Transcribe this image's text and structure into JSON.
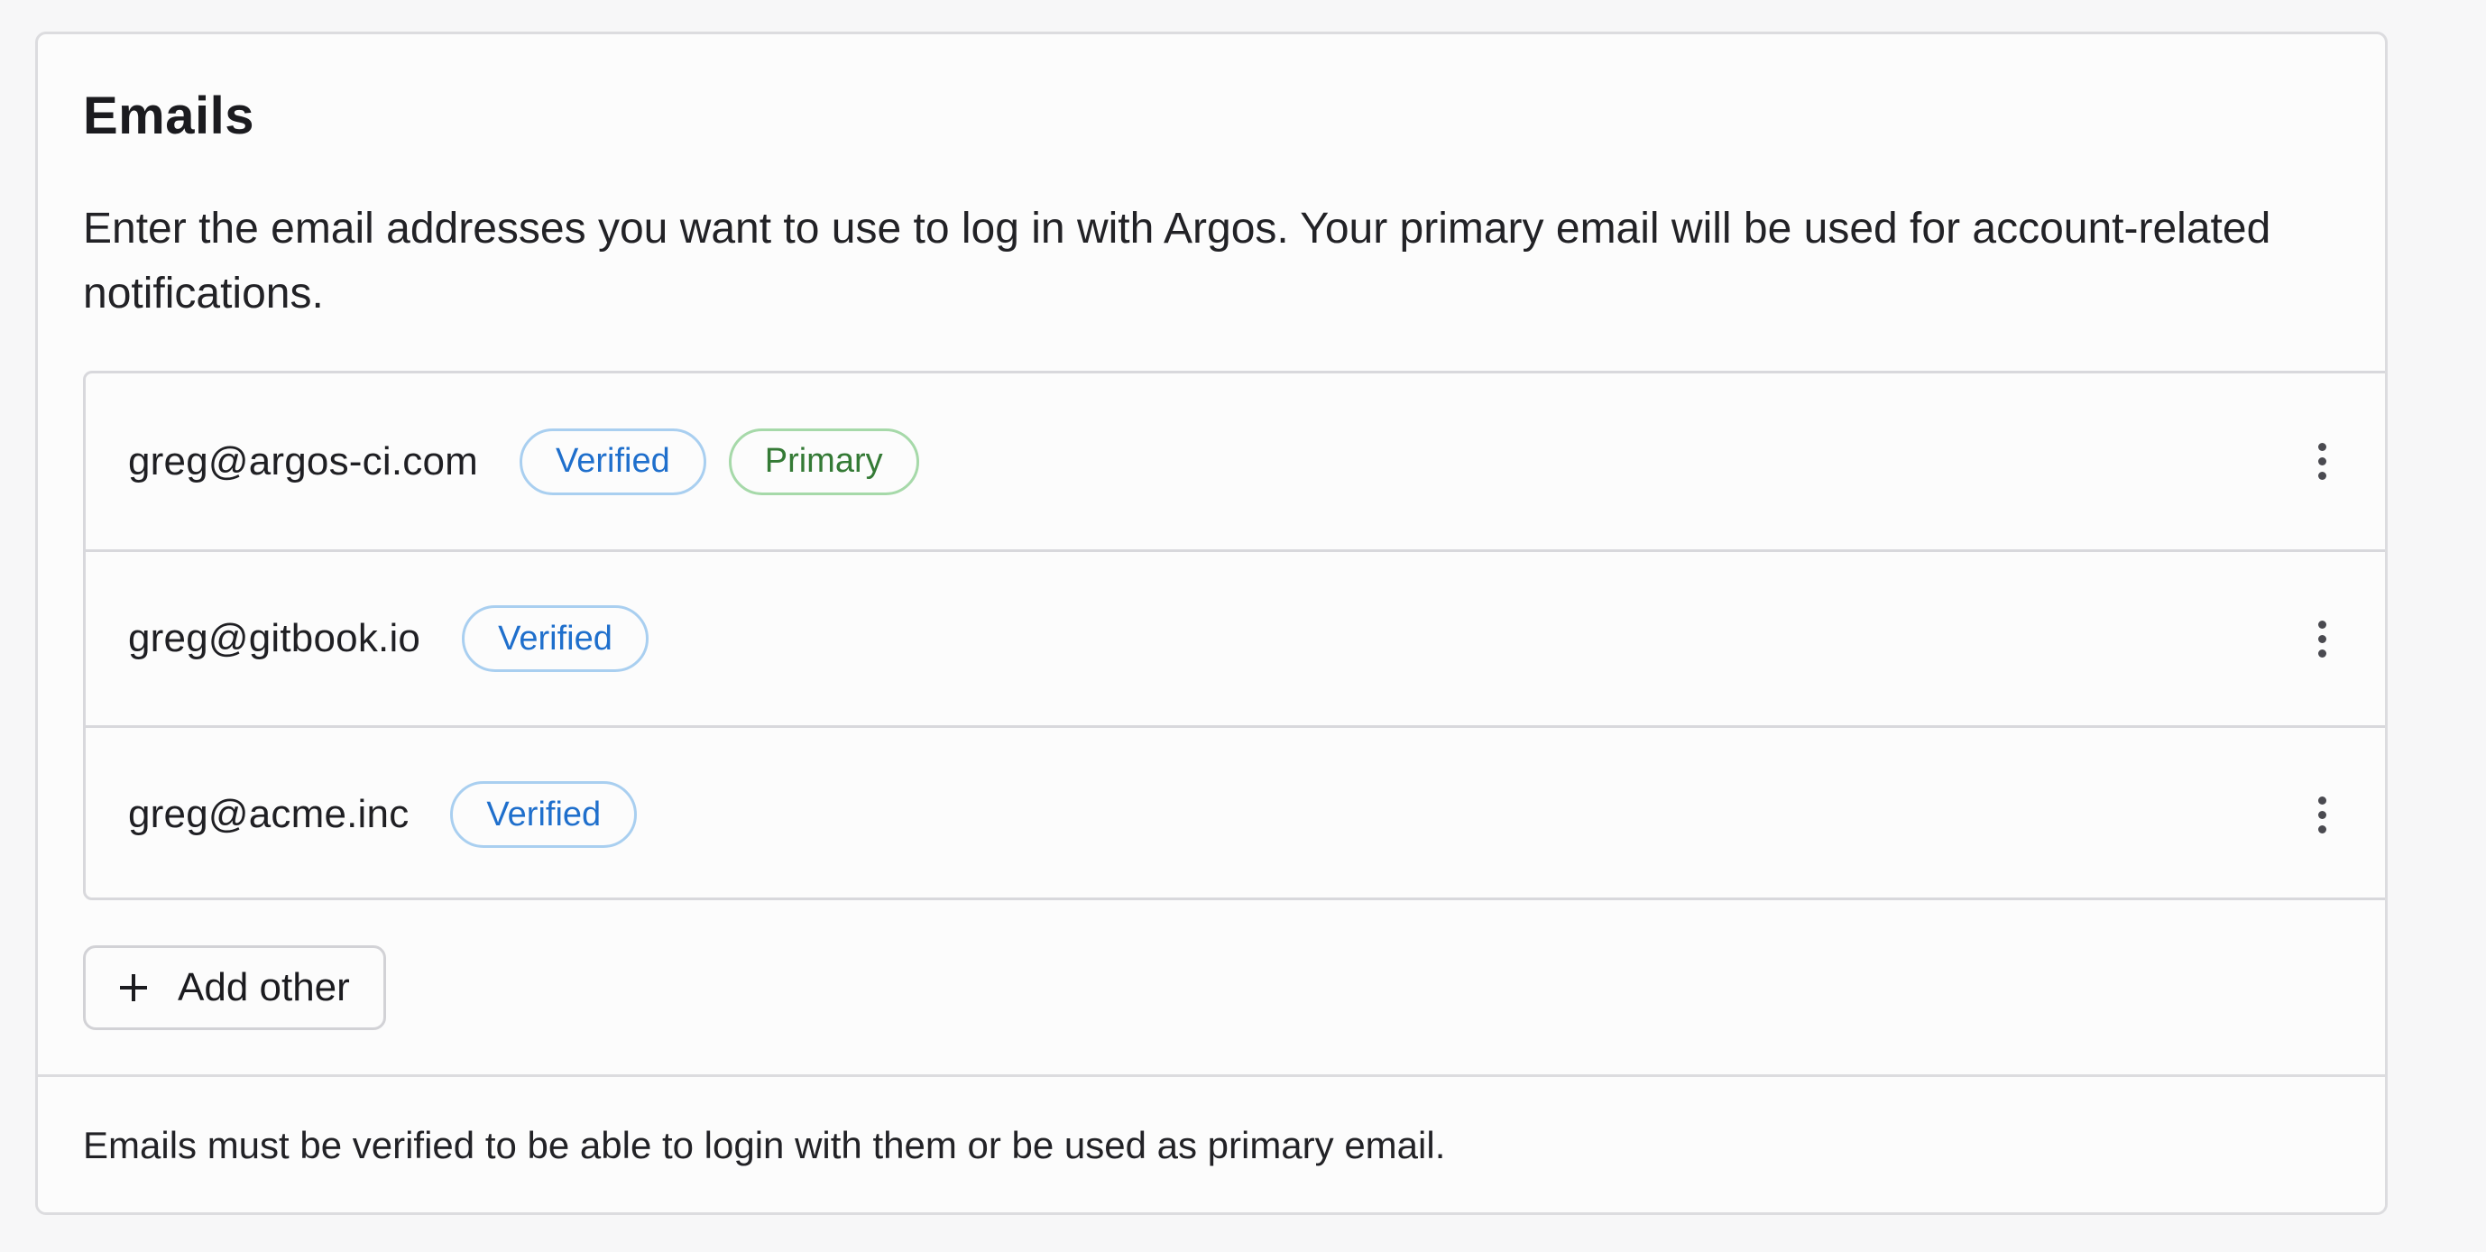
{
  "section": {
    "title": "Emails",
    "description": "Enter the email addresses you want to use to log in with Argos. Your primary email will be used for account-related notifications."
  },
  "emails": [
    {
      "address": "greg@argos-ci.com",
      "badges": [
        "Verified",
        "Primary"
      ]
    },
    {
      "address": "greg@gitbook.io",
      "badges": [
        "Verified"
      ]
    },
    {
      "address": "greg@acme.inc",
      "badges": [
        "Verified"
      ]
    }
  ],
  "actions": {
    "add_label": "Add other",
    "row_menu_icon": "more-vertical-icon",
    "add_icon": "plus-icon"
  },
  "footer": {
    "note": "Emails must be verified to be able to login with them or be used as primary email."
  },
  "colors": {
    "verified": "#1f6fcc",
    "primary": "#347a35"
  }
}
